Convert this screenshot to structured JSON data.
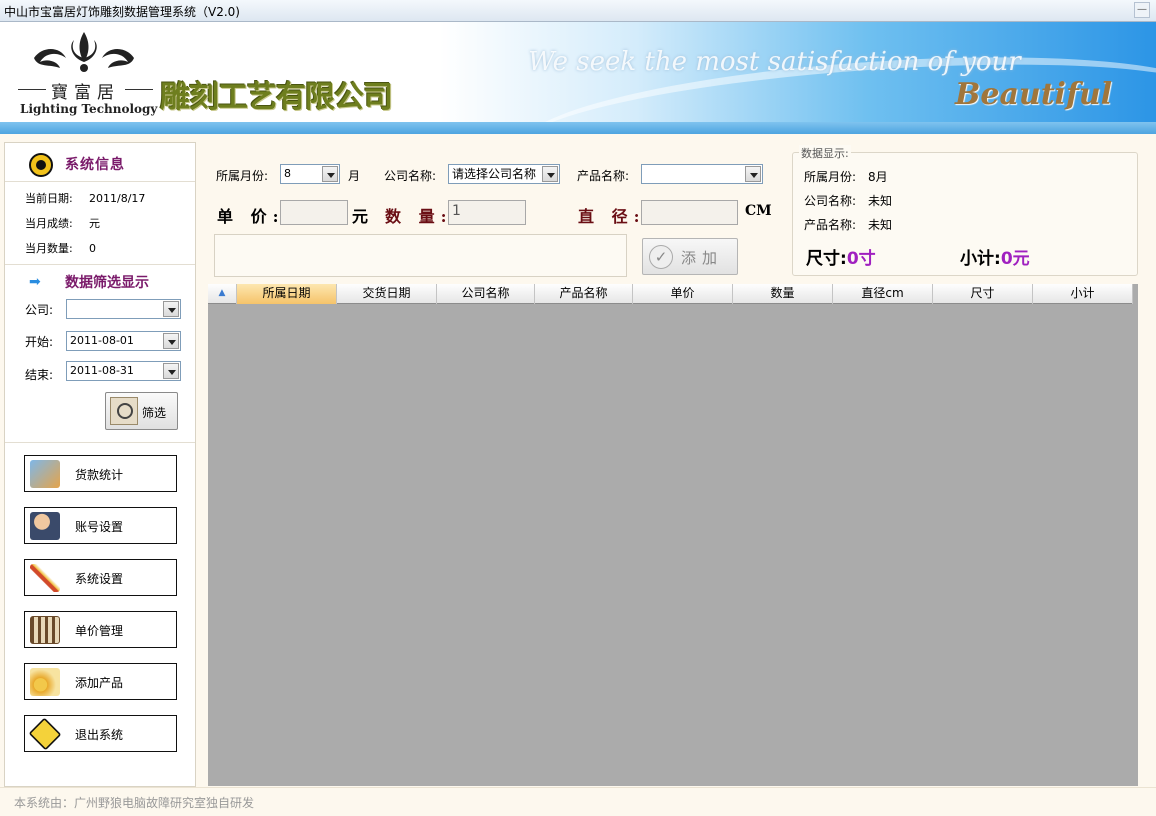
{
  "window": {
    "title": "中山市宝富居灯饰雕刻数据管理系统（V2.0)"
  },
  "banner": {
    "logo_cn": "寶富居",
    "logo_en": "Lighting Technology",
    "company": "雕刻工艺有限公司",
    "slogan": "We seek the most satisfaction of your",
    "beautiful": "Beautiful"
  },
  "sidebar": {
    "system_info": {
      "heading": "系统信息",
      "date_label": "当前日期:",
      "date_value": "2011/8/17",
      "perf_label": "当月成绩:",
      "perf_value": "元",
      "qty_label": "当月数量:",
      "qty_value": "0"
    },
    "filter": {
      "heading": "数据筛选显示",
      "company_label": "公司:",
      "company_value": "",
      "start_label": "开始:",
      "start_value": "2011-08-01",
      "end_label": "结束:",
      "end_value": "2011-08-31",
      "button_label": "筛选"
    },
    "nav": [
      {
        "label": "货款统计",
        "icon": "payment-icon"
      },
      {
        "label": "账号设置",
        "icon": "users-icon"
      },
      {
        "label": "系统设置",
        "icon": "tools-icon"
      },
      {
        "label": "单价管理",
        "icon": "abacus-icon"
      },
      {
        "label": "添加产品",
        "icon": "gears-icon"
      },
      {
        "label": "退出系统",
        "icon": "exit-sign-icon"
      }
    ]
  },
  "form": {
    "month_label": "所属月份:",
    "month_value": "8",
    "month_suffix": "月",
    "company_label": "公司名称:",
    "company_value": "请选择公司名称",
    "product_label": "产品名称:",
    "product_value": "",
    "price_label": "单 价:",
    "price_value": "",
    "price_unit": "元",
    "qty_label": "数 量:",
    "qty_value": "1",
    "diameter_label": "直 径:",
    "diameter_value": "",
    "diameter_unit": "CM",
    "add_button": "添加"
  },
  "data_display": {
    "title": "数据显示:",
    "month_label": "所属月份:",
    "month_value": "8月",
    "company_label": "公司名称:",
    "company_value": "未知",
    "product_label": "产品名称:",
    "product_value": "未知",
    "size_label": "尺寸:",
    "size_value": "0寸",
    "subtotal_label": "小计:",
    "subtotal_value": "0元"
  },
  "table": {
    "columns": [
      "所属日期",
      "交货日期",
      "公司名称",
      "产品名称",
      "单价",
      "数量",
      "直径cm",
      "尺寸",
      "小计"
    ],
    "rows": []
  },
  "footer": {
    "text": "本系统由：广州野狼电脑故障研究室独自研发"
  },
  "colors": {
    "accent_purple": "#a020c0",
    "heading_maroon": "#7a1a6a",
    "grid_bg": "#ababab"
  }
}
